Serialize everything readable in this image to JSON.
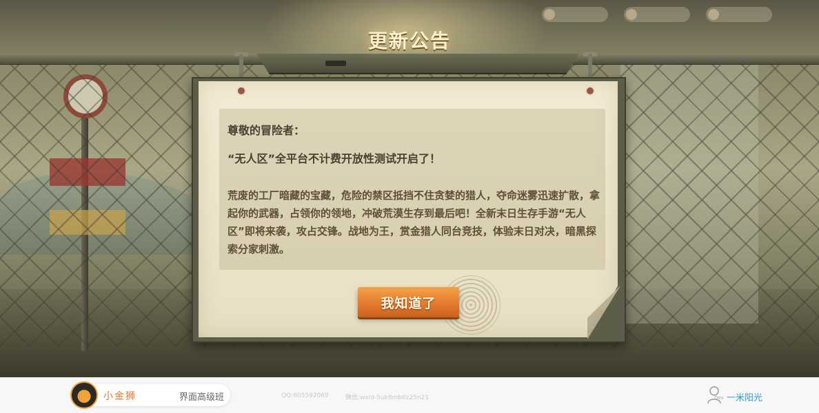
{
  "dialog": {
    "title": "更新公告",
    "greeting": "尊敬的冒险者：",
    "headline": "“无人区”全平台不计费开放性测试开启了！",
    "body": "荒废的工厂暗藏的宝藏，危险的禁区抵挡不住贪婪的猎人，夺命迷雾迅速扩散，拿起你的武器，占领你的领地，冲破荒漠生存到最后吧！全新末日生存手游“无人区”即将来袭，攻占交锋。战地为王，赏金猎人同台竞技，体验末日对决，暗黑探索分家刺激。",
    "confirm_label": "我知道了"
  },
  "footer": {
    "brand_name": "小金狮",
    "course": "界面高级班",
    "qq": "QQ:605592069",
    "wechat": "微信:wxid-5uk8mb6z25n21",
    "user_tag": "Des",
    "user_name": "一米阳光"
  },
  "colors": {
    "accent_orange": "#e2772b",
    "title_cream": "#fbf1cc",
    "text_brown": "#4b4032",
    "link_blue": "#2a9fe0"
  }
}
